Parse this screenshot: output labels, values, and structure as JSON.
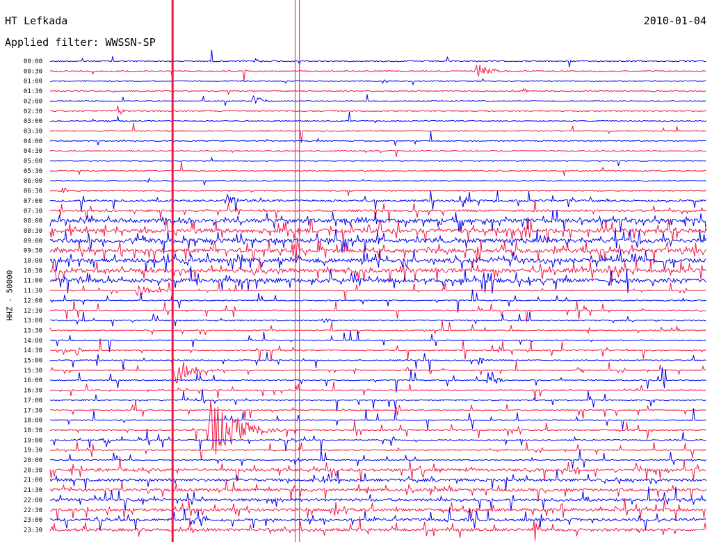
{
  "header": {
    "station": "HT Lefkada",
    "filter": "Applied filter: WWSSN-SP",
    "date": "2010-01-04"
  },
  "axis": {
    "ylabel": "HHZ - 50000"
  },
  "colors": {
    "trace_a": "#0000ee",
    "trace_b": "#ee1744",
    "marker": "#ee1744",
    "text": "#000000"
  },
  "chart_data": {
    "type": "line",
    "y_tick_labels": [
      "00:00",
      "00:30",
      "01:00",
      "01:30",
      "02:00",
      "02:30",
      "03:00",
      "03:30",
      "04:00",
      "04:30",
      "05:00",
      "05:30",
      "06:00",
      "06:30",
      "07:00",
      "07:30",
      "08:00",
      "08:30",
      "09:00",
      "09:30",
      "10:00",
      "10:30",
      "11:00",
      "11:30",
      "12:00",
      "12:30",
      "13:00",
      "13:30",
      "14:00",
      "14:30",
      "15:00",
      "15:30",
      "16:00",
      "16:30",
      "17:00",
      "17:30",
      "18:00",
      "18:30",
      "19:00",
      "19:30",
      "20:00",
      "20:30",
      "21:00",
      "21:30",
      "22:00",
      "22:30",
      "23:00",
      "23:30"
    ],
    "series_colors": [
      "#0000ee",
      "#ee1744"
    ],
    "x_range_minutes": [
      0,
      30
    ],
    "markers_minutes": [
      {
        "at": 5.6,
        "color": "#ee1744",
        "kind": "thick"
      },
      {
        "at": 11.2,
        "color": "#ee1744",
        "kind": "thin"
      },
      {
        "at": 11.4,
        "color": "#ee1744",
        "kind": "thin"
      }
    ],
    "events": [
      {
        "row": 0,
        "at": 9.4,
        "amp": 6
      },
      {
        "row": 1,
        "at": 19.5,
        "amp": 14,
        "duration": 1.6
      },
      {
        "row": 2,
        "at": 15.2,
        "amp": 7
      },
      {
        "row": 3,
        "at": 21.6,
        "amp": 6
      },
      {
        "row": 4,
        "at": 9.3,
        "amp": 8,
        "duration": 1.2
      },
      {
        "row": 5,
        "at": 3.1,
        "amp": 11
      },
      {
        "row": 12,
        "at": 4.5,
        "amp": 5
      },
      {
        "row": 13,
        "at": 0.6,
        "amp": 10
      },
      {
        "row": 14,
        "at": 8.0,
        "amp": 12,
        "duration": 1.3
      },
      {
        "row": 23,
        "at": 4.0,
        "amp": 14,
        "duration": 1.5
      },
      {
        "row": 26,
        "at": 12.5,
        "amp": 10
      },
      {
        "row": 29,
        "at": 0.6,
        "amp": 10
      },
      {
        "row": 29,
        "at": 1.2,
        "amp": 9
      },
      {
        "row": 30,
        "at": 19.6,
        "amp": 10
      },
      {
        "row": 31,
        "at": 5.7,
        "amp": 24,
        "duration": 1.8
      },
      {
        "row": 31,
        "at": 24.1,
        "amp": 8
      },
      {
        "row": 32,
        "at": 20.0,
        "amp": 12,
        "duration": 1.2
      },
      {
        "row": 38,
        "at": 2.5,
        "amp": 18
      },
      {
        "row": 37,
        "at": 7.3,
        "amp": 48,
        "duration": 3.5
      },
      {
        "row": 40,
        "at": 11.2,
        "amp": 8
      }
    ]
  }
}
